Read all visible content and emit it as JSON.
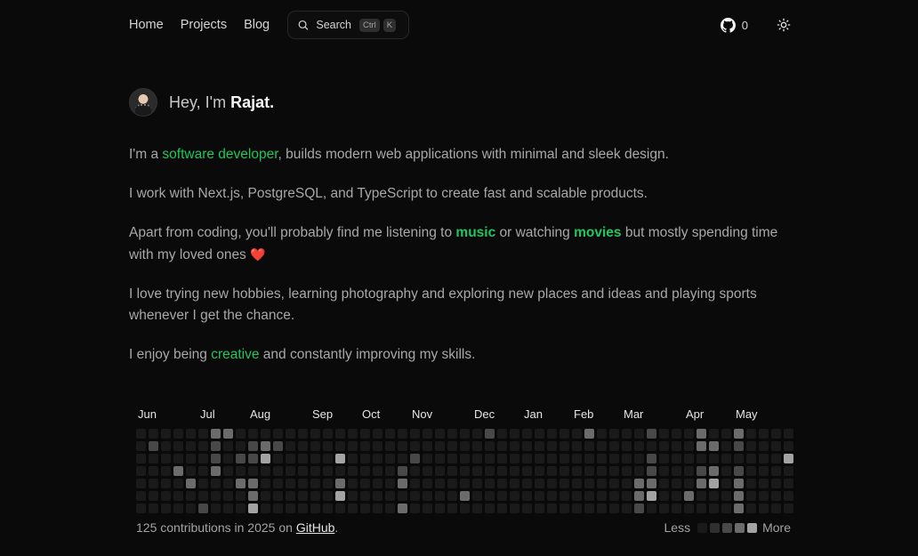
{
  "nav": {
    "links": [
      "Home",
      "Projects",
      "Blog"
    ],
    "search_label": "Search",
    "search_keys": [
      "Ctrl",
      "K"
    ],
    "github_count": "0"
  },
  "hero": {
    "greeting_prefix": "Hey, I'm ",
    "name": "Rajat."
  },
  "bio": {
    "p1_pre": "I'm a ",
    "p1_hl": "software developer",
    "p1_post": ", builds modern web applications with minimal and sleek design.",
    "p2": "I work with Next.js, PostgreSQL, and TypeScript to create fast and scalable products.",
    "p3_pre": "Apart from coding, you'll probably find me listening to ",
    "p3_hl1": "music",
    "p3_mid": " or watching ",
    "p3_hl2": "movies",
    "p3_post": " but mostly spending time with my loved ones ",
    "p3_emoji": "❤️",
    "p4": "I love trying new hobbies, learning photography and exploring new places and ideas and playing sports whenever I get the chance.",
    "p5_pre": "I enjoy being ",
    "p5_hl": "creative",
    "p5_post": " and constantly improving my skills."
  },
  "contributions": {
    "months": [
      {
        "label": "Jun",
        "week": 1
      },
      {
        "label": "Jul",
        "week": 6
      },
      {
        "label": "Aug",
        "week": 10
      },
      {
        "label": "Sep",
        "week": 15
      },
      {
        "label": "Oct",
        "week": 19
      },
      {
        "label": "Nov",
        "week": 23
      },
      {
        "label": "Dec",
        "week": 28
      },
      {
        "label": "Jan",
        "week": 32
      },
      {
        "label": "Feb",
        "week": 36
      },
      {
        "label": "Mar",
        "week": 40
      },
      {
        "label": "Apr",
        "week": 45
      },
      {
        "label": "May",
        "week": 49
      }
    ],
    "weeks": 53,
    "level_colors": [
      "#1a1a1a",
      "#2f2f2f",
      "#484848",
      "#6b6b6b",
      "#a3a3a3"
    ],
    "active": [
      [
        6,
        0,
        3
      ],
      [
        7,
        0,
        3
      ],
      [
        28,
        0,
        2
      ],
      [
        36,
        0,
        3
      ],
      [
        41,
        0,
        2
      ],
      [
        45,
        0,
        3
      ],
      [
        48,
        0,
        3
      ],
      [
        1,
        1,
        2
      ],
      [
        6,
        1,
        2
      ],
      [
        9,
        1,
        2
      ],
      [
        10,
        1,
        3
      ],
      [
        11,
        1,
        2
      ],
      [
        45,
        1,
        3
      ],
      [
        46,
        1,
        3
      ],
      [
        48,
        1,
        2
      ],
      [
        6,
        2,
        2
      ],
      [
        8,
        2,
        2
      ],
      [
        9,
        2,
        2
      ],
      [
        10,
        2,
        4
      ],
      [
        16,
        2,
        4
      ],
      [
        22,
        2,
        2
      ],
      [
        41,
        2,
        2
      ],
      [
        52,
        2,
        4
      ],
      [
        3,
        3,
        3
      ],
      [
        6,
        3,
        3
      ],
      [
        21,
        3,
        2
      ],
      [
        41,
        3,
        2
      ],
      [
        45,
        3,
        2
      ],
      [
        46,
        3,
        3
      ],
      [
        48,
        3,
        2
      ],
      [
        4,
        4,
        3
      ],
      [
        8,
        4,
        3
      ],
      [
        9,
        4,
        3
      ],
      [
        16,
        4,
        3
      ],
      [
        21,
        4,
        3
      ],
      [
        40,
        4,
        3
      ],
      [
        41,
        4,
        3
      ],
      [
        45,
        4,
        3
      ],
      [
        46,
        4,
        4
      ],
      [
        48,
        4,
        3
      ],
      [
        9,
        5,
        3
      ],
      [
        16,
        5,
        4
      ],
      [
        26,
        5,
        3
      ],
      [
        40,
        5,
        3
      ],
      [
        41,
        5,
        4
      ],
      [
        44,
        5,
        3
      ],
      [
        48,
        5,
        3
      ],
      [
        5,
        6,
        2
      ],
      [
        9,
        6,
        4
      ],
      [
        21,
        6,
        3
      ],
      [
        40,
        6,
        2
      ],
      [
        48,
        6,
        3
      ]
    ],
    "footer_pre": "125 contributions in 2025 on ",
    "footer_link": "GitHub",
    "footer_post": ".",
    "legend_less": "Less",
    "legend_more": "More"
  }
}
